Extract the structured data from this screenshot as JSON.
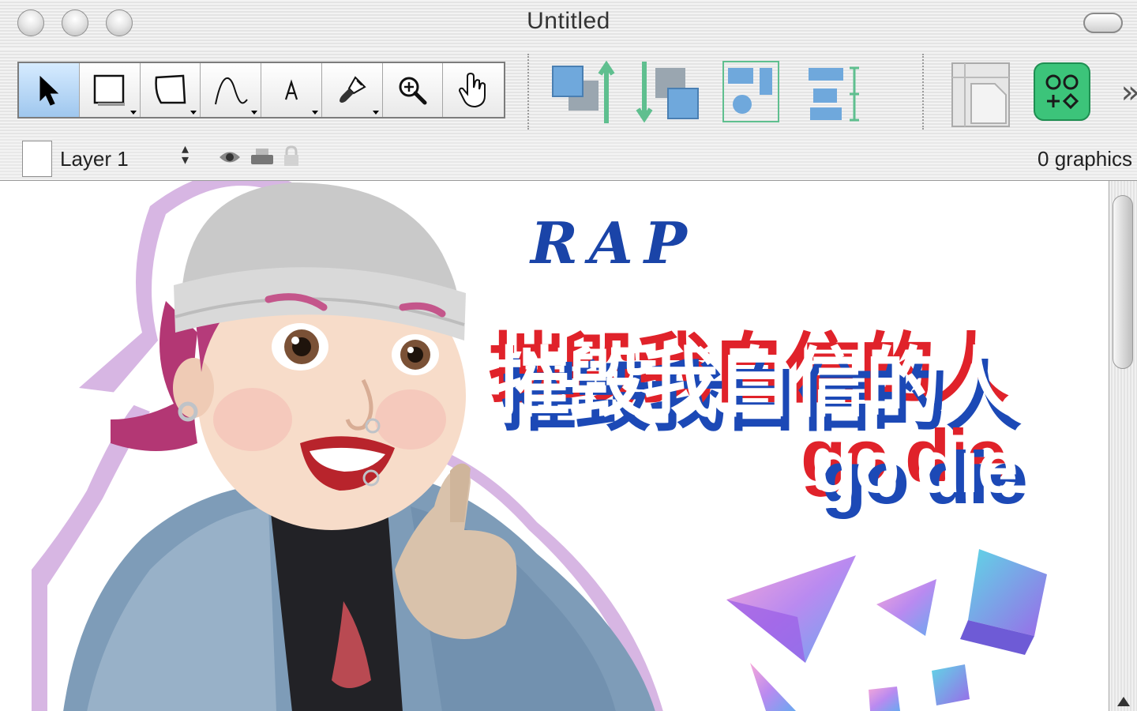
{
  "window": {
    "title": "Untitled"
  },
  "toolbar": {
    "tools": [
      {
        "name": "selection-tool",
        "icon": "arrow-pointer-icon",
        "selected": true
      },
      {
        "name": "rectangle-tool",
        "icon": "rectangle-icon"
      },
      {
        "name": "shape-tool",
        "icon": "shape-icon"
      },
      {
        "name": "line-tool",
        "icon": "curve-line-icon"
      },
      {
        "name": "text-tool",
        "icon": "text-a-icon",
        "label": "A"
      },
      {
        "name": "style-brush-tool",
        "icon": "paint-brush-icon"
      },
      {
        "name": "magnify-tool",
        "icon": "magnifier-plus-icon"
      },
      {
        "name": "hand-tool",
        "icon": "hand-pointer-icon"
      }
    ],
    "arrange_icons": [
      "bring-to-front-icon",
      "send-to-back-icon",
      "align-icon",
      "distribute-icon"
    ],
    "right_icons": [
      "canvas-sizes-icon",
      "inspectors-icon"
    ],
    "overflow": "»"
  },
  "layerbar": {
    "layer_name": "Layer 1",
    "graphics_count": "0 graphics"
  },
  "canvas": {
    "rap": "RAP",
    "headline": "摧毁我自信的人",
    "subline": "go die"
  },
  "colors": {
    "red": "#e0222a",
    "blue": "#1c49b6",
    "rap_blue": "#1a44a8",
    "accent_green": "#3cc47a"
  }
}
